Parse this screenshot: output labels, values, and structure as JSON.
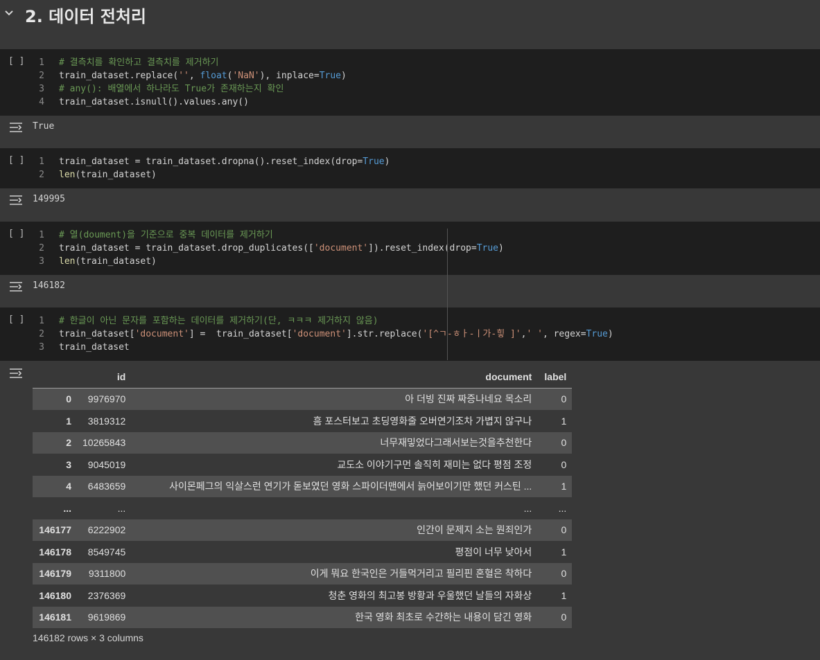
{
  "section": {
    "title": "2. 데이터 전처리"
  },
  "run_label": "[ ]",
  "cells": [
    {
      "lines": [
        [
          {
            "t": "cm",
            "v": "# 결측치를 확인하고 결측치를 제거하기"
          }
        ],
        [
          {
            "t": "txt",
            "v": "train_dataset.replace("
          },
          {
            "t": "st",
            "v": "''"
          },
          {
            "t": "txt",
            "v": ", "
          },
          {
            "t": "kw",
            "v": "float"
          },
          {
            "t": "txt",
            "v": "("
          },
          {
            "t": "st",
            "v": "'NaN'"
          },
          {
            "t": "txt",
            "v": "), inplace="
          },
          {
            "t": "kw",
            "v": "True"
          },
          {
            "t": "txt",
            "v": ")"
          }
        ],
        [
          {
            "t": "cm",
            "v": "# any(): 배열에서 하나라도 True가 존재하는지 확인"
          }
        ],
        [
          {
            "t": "txt",
            "v": "train_dataset.isnull().values.any()"
          }
        ]
      ],
      "output": "True"
    },
    {
      "lines": [
        [
          {
            "t": "txt",
            "v": "train_dataset = train_dataset.dropna().reset_index(drop="
          },
          {
            "t": "kw",
            "v": "True"
          },
          {
            "t": "txt",
            "v": ")"
          }
        ],
        [
          {
            "t": "fn",
            "v": "len"
          },
          {
            "t": "txt",
            "v": "(train_dataset)"
          }
        ]
      ],
      "output": "149995"
    },
    {
      "lines": [
        [
          {
            "t": "cm",
            "v": "# 열(doument)을 기준으로 중복 데이터를 제거하기"
          }
        ],
        [
          {
            "t": "txt",
            "v": "train_dataset = train_dataset.drop_duplicates(["
          },
          {
            "t": "st",
            "v": "'document'"
          },
          {
            "t": "txt",
            "v": "]).reset_index(drop="
          },
          {
            "t": "kw",
            "v": "True"
          },
          {
            "t": "txt",
            "v": ")"
          }
        ],
        [
          {
            "t": "fn",
            "v": "len"
          },
          {
            "t": "txt",
            "v": "(train_dataset)"
          }
        ]
      ],
      "output": "146182"
    },
    {
      "lines": [
        [
          {
            "t": "cm",
            "v": "# 한글이 아닌 문자를 포함하는 데이터를 제거하기(단, ㅋㅋㅋ 제거하지 않음)"
          }
        ],
        [
          {
            "t": "txt",
            "v": "train_dataset["
          },
          {
            "t": "st",
            "v": "'document'"
          },
          {
            "t": "txt",
            "v": "] =  train_dataset["
          },
          {
            "t": "st",
            "v": "'document'"
          },
          {
            "t": "txt",
            "v": "].str.replace("
          },
          {
            "t": "st",
            "v": "'[^ㄱ-ㅎㅏ-ㅣ가-힣 ]'"
          },
          {
            "t": "txt",
            "v": ","
          },
          {
            "t": "st",
            "v": "' '"
          },
          {
            "t": "txt",
            "v": ", regex="
          },
          {
            "t": "kw",
            "v": "True"
          },
          {
            "t": "txt",
            "v": ")"
          }
        ],
        [
          {
            "t": "txt",
            "v": "train_dataset"
          }
        ]
      ],
      "output": ""
    }
  ],
  "table": {
    "columns": [
      "",
      "id",
      "document",
      "label"
    ],
    "rows": [
      [
        "0",
        "9976970",
        "아 더빙 진짜 짜증나네요 목소리",
        "0"
      ],
      [
        "1",
        "3819312",
        "흠 포스터보고 초딩영화줄 오버연기조차 가볍지 않구나",
        "1"
      ],
      [
        "2",
        "10265843",
        "너무재밓었다그래서보는것을추천한다",
        "0"
      ],
      [
        "3",
        "9045019",
        "교도소 이야기구먼 솔직히 재미는 없다 평점 조정",
        "0"
      ],
      [
        "4",
        "6483659",
        "사이몬페그의 익살스런 연기가 돋보였던 영화 스파이더맨에서 늙어보이기만 했던 커스틴 ...",
        "1"
      ],
      [
        "...",
        "...",
        "...",
        "..."
      ],
      [
        "146177",
        "6222902",
        "인간이 문제지 소는 뭔죄인가",
        "0"
      ],
      [
        "146178",
        "8549745",
        "평점이 너무 낮아서",
        "1"
      ],
      [
        "146179",
        "9311800",
        "이게 뭐요 한국인은 거들먹거리고 필리핀 혼혈은 착하다",
        "0"
      ],
      [
        "146180",
        "2376369",
        "청춘 영화의 최고봉 방황과 우울했던 날들의 자화상",
        "1"
      ],
      [
        "146181",
        "9619869",
        "한국 영화 최초로 수간하는 내용이 담긴 영화",
        "0"
      ]
    ],
    "footer": "146182 rows × 3 columns"
  }
}
